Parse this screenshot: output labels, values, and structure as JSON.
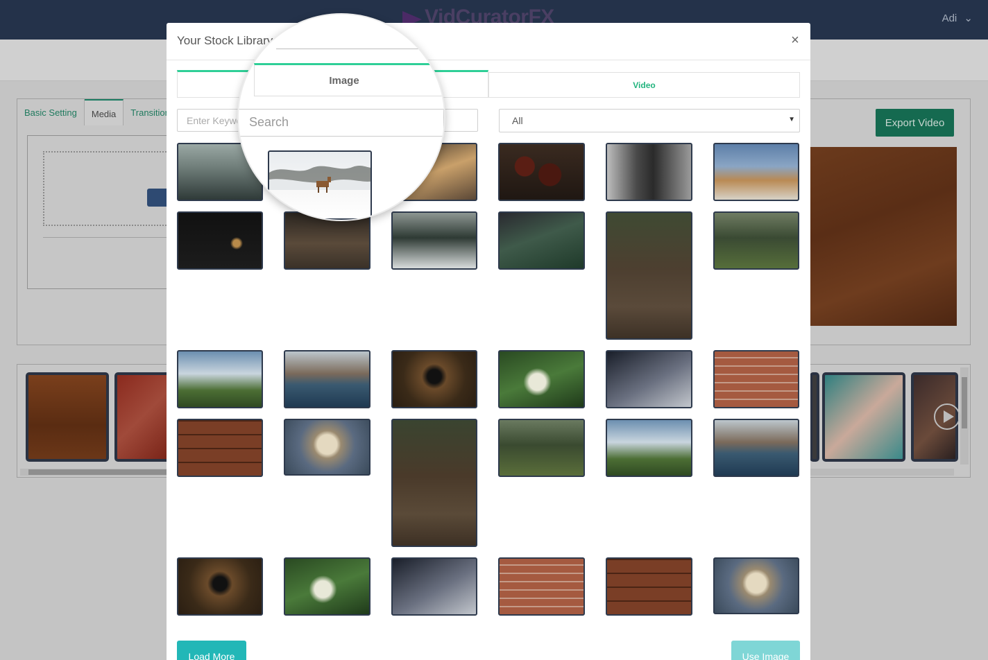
{
  "app": {
    "brand": "VidCuratorFX",
    "user_name": "Adi",
    "user_caret": "⌄"
  },
  "editor": {
    "tabs": [
      {
        "label": "Basic Setting"
      },
      {
        "label": "Media"
      },
      {
        "label": "Transition"
      }
    ],
    "export_label": "Export Video"
  },
  "modal": {
    "title": "Your Stock Library",
    "close_glyph": "×",
    "tabs": [
      {
        "label": "Image",
        "active": true
      },
      {
        "label": "Video",
        "active": false
      }
    ],
    "search_placeholder": "Enter Keyword Search",
    "type_select_value": "All",
    "select_caret": "▼",
    "load_more_label": "Load More",
    "use_image_label": "Use Image"
  },
  "magnifier": {
    "tab_label": "Image",
    "search_text": "Search"
  },
  "colors": {
    "accent_green": "#2fcf97",
    "tab_green_text": "#22b47e",
    "teal_button": "#22b7b7",
    "teal_button_disabled": "#7fd6d6",
    "export_button": "#156a50",
    "topbar": "#24324a"
  },
  "icons": {
    "close": "close-icon",
    "caret": "chevron-down-icon",
    "play": "play-icon"
  }
}
